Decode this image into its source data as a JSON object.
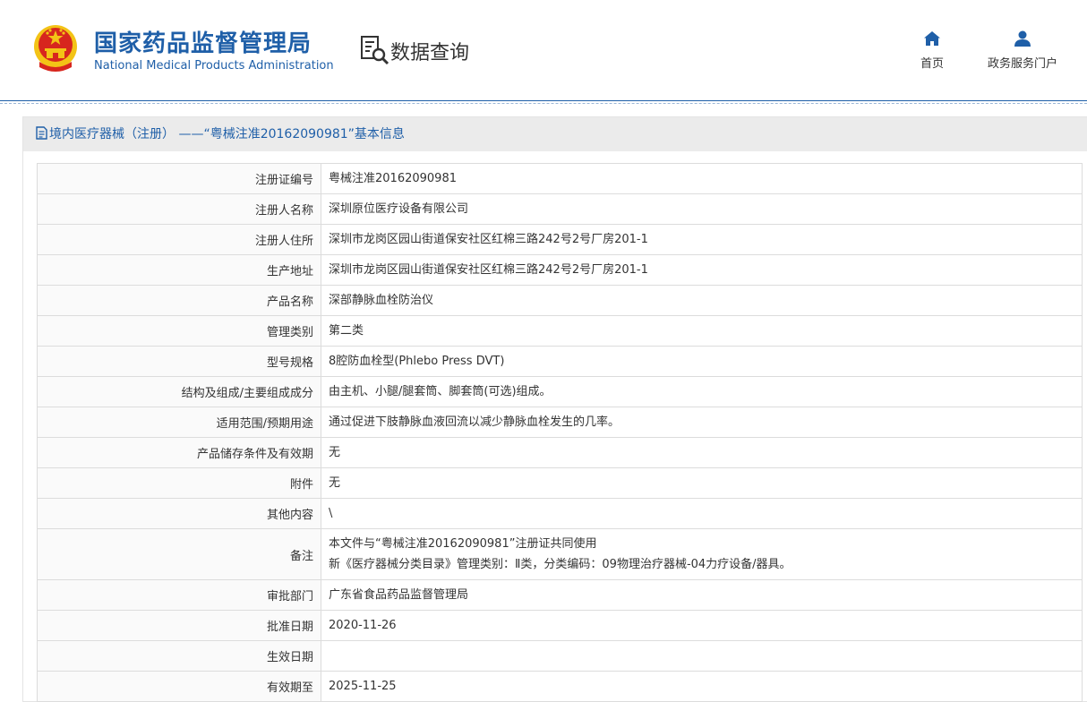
{
  "header": {
    "brand_cn": "国家药品监督管理局",
    "brand_en": "National Medical Products Administration",
    "section_title": "数据查询",
    "nav": {
      "home_label": "首页",
      "portal_label": "政务服务门户"
    }
  },
  "panel": {
    "title": "境内医疗器械（注册） ——“粤械注准20162090981”基本信息"
  },
  "rows": [
    {
      "label": "注册证编号",
      "value": "粤械注准20162090981"
    },
    {
      "label": "注册人名称",
      "value": "深圳原位医疗设备有限公司"
    },
    {
      "label": "注册人住所",
      "value": "深圳市龙岗区园山街道保安社区红棉三路242号2号厂房201-1"
    },
    {
      "label": "生产地址",
      "value": "深圳市龙岗区园山街道保安社区红棉三路242号2号厂房201-1"
    },
    {
      "label": "产品名称",
      "value": "深部静脉血栓防治仪"
    },
    {
      "label": "管理类别",
      "value": "第二类"
    },
    {
      "label": "型号规格",
      "value": "8腔防血栓型(Phlebo Press DVT)"
    },
    {
      "label": "结构及组成/主要组成成分",
      "value": "由主机、小腿/腿套筒、脚套筒(可选)组成。"
    },
    {
      "label": "适用范围/预期用途",
      "value": "通过促进下肢静脉血液回流以减少静脉血栓发生的几率。"
    },
    {
      "label": "产品储存条件及有效期",
      "value": "无"
    },
    {
      "label": "附件",
      "value": "无"
    },
    {
      "label": "其他内容",
      "value": "\\"
    },
    {
      "label": "备注",
      "value_line1": "本文件与“粤械注准20162090981”注册证共同使用",
      "value_line2": "新《医疗器械分类目录》管理类别：Ⅱ类，分类编码：09物理治疗器械-04力疗设备/器具。"
    },
    {
      "label": "审批部门",
      "value": "广东省食品药品监督管理局"
    },
    {
      "label": "批准日期",
      "value": "2020-11-26"
    },
    {
      "label": "生效日期",
      "value": ""
    },
    {
      "label": "有效期至",
      "value": "2025-11-25"
    }
  ],
  "colors": {
    "brand_blue": "#1f5fa8",
    "emblem_red": "#d7261e",
    "emblem_gold": "#f3c316"
  },
  "icons": {
    "emblem": "national-emblem-icon",
    "search": "document-search-icon",
    "home": "home-icon",
    "portal": "user-icon",
    "panel": "document-icon"
  }
}
